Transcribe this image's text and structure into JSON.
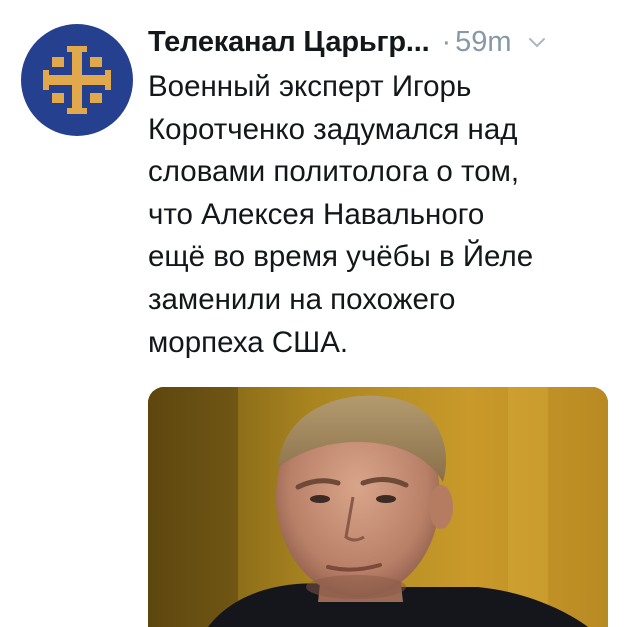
{
  "tweet": {
    "author": {
      "display_name": "Телеканал Царьгр...",
      "avatar_icon": "cross-logo-icon"
    },
    "separator": "·",
    "timestamp": "59m",
    "menu_icon": "chevron-down-icon",
    "text_lines": [
      "Военный эксперт Игорь",
      "Коротченко задумался над",
      "словами политолога о том,",
      "что Алексея Навального",
      "ещё во время учёбы в Йеле",
      "заменили на похожего",
      "морпеха США."
    ],
    "media": {
      "kind": "photo"
    }
  },
  "colors": {
    "avatar_bg": "#24408f",
    "avatar_emblem": "#e1a94b",
    "text_primary": "#14171a",
    "text_secondary": "#8899a6"
  }
}
